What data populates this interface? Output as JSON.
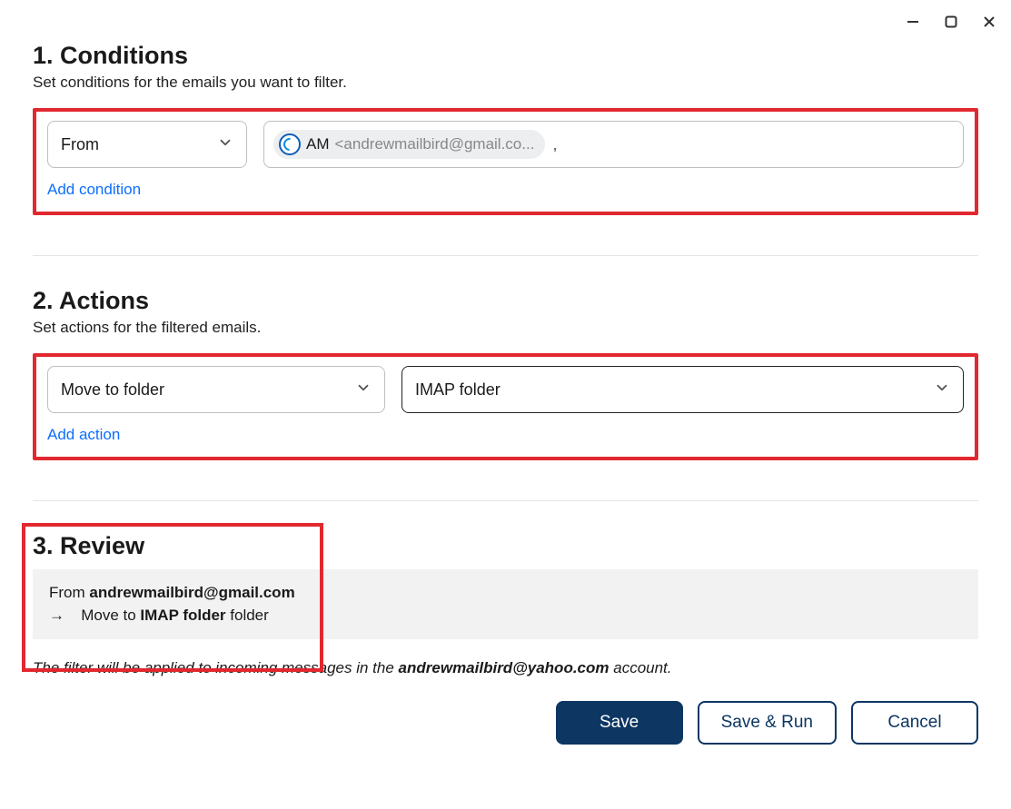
{
  "window": {
    "minimize": "–",
    "maximize": "□",
    "close": "×"
  },
  "conditions": {
    "title": "1. Conditions",
    "subtitle": "Set conditions for the emails you want to filter.",
    "select_label": "From",
    "chip_initials": "AM",
    "chip_email": "<andrewmailbird@gmail.co...",
    "trailing": ",",
    "add_link": "Add condition"
  },
  "actions": {
    "title": "2. Actions",
    "subtitle": "Set actions for the filtered emails.",
    "select1_label": "Move to folder",
    "select2_label": "IMAP folder",
    "add_link": "Add action"
  },
  "review": {
    "title": "3. Review",
    "line1_prefix": "From ",
    "line1_bold": "andrewmailbird@gmail.com",
    "line2_arrow": "→",
    "line2_prefix": "Move to ",
    "line2_bold": "IMAP folder",
    "line2_suffix": " folder",
    "note_prefix": "The filter will be applied to incoming messages in the ",
    "note_bold": "andrewmailbird@yahoo.com",
    "note_suffix": " account."
  },
  "buttons": {
    "save": "Save",
    "save_run": "Save & Run",
    "cancel": "Cancel"
  }
}
